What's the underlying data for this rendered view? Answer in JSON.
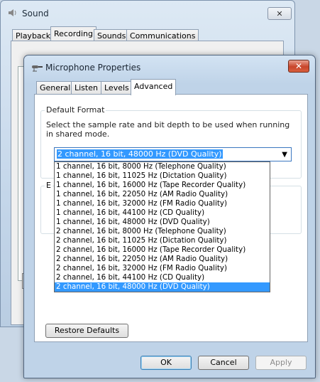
{
  "sound_window": {
    "title": "Sound",
    "close_label": "✕",
    "tabs": [
      "Playback",
      "Recording",
      "Sounds",
      "Communications"
    ]
  },
  "dialog": {
    "title": "Microphone Properties",
    "close_label": "✕",
    "tabs": [
      "General",
      "Listen",
      "Levels",
      "Advanced"
    ],
    "active_tab": "Advanced",
    "default_format": {
      "group_label": "Default Format",
      "description": "Select the sample rate and bit depth to be used when running in shared mode.",
      "selected": "2 channel, 16 bit, 48000 Hz (DVD Quality)",
      "options": [
        "1 channel, 16 bit, 8000 Hz (Telephone Quality)",
        "1 channel, 16 bit, 11025 Hz (Dictation Quality)",
        "1 channel, 16 bit, 16000 Hz (Tape Recorder Quality)",
        "1 channel, 16 bit, 22050 Hz (AM Radio Quality)",
        "1 channel, 16 bit, 32000 Hz (FM Radio Quality)",
        "1 channel, 16 bit, 44100 Hz (CD Quality)",
        "1 channel, 16 bit, 48000 Hz (DVD Quality)",
        "2 channel, 16 bit, 8000 Hz (Telephone Quality)",
        "2 channel, 16 bit, 11025 Hz (Dictation Quality)",
        "2 channel, 16 bit, 16000 Hz (Tape Recorder Quality)",
        "2 channel, 16 bit, 22050 Hz (AM Radio Quality)",
        "2 channel, 16 bit, 32000 Hz (FM Radio Quality)",
        "2 channel, 16 bit, 44100 Hz (CD Quality)",
        "2 channel, 16 bit, 48000 Hz (DVD Quality)"
      ],
      "highlighted_index": 13
    },
    "second_group_label": "E",
    "restore_label": "Restore Defaults",
    "ok_label": "OK",
    "cancel_label": "Cancel",
    "apply_label": "Apply"
  },
  "colors": {
    "selection": "#3399ff",
    "close_button": "#c8452a"
  }
}
